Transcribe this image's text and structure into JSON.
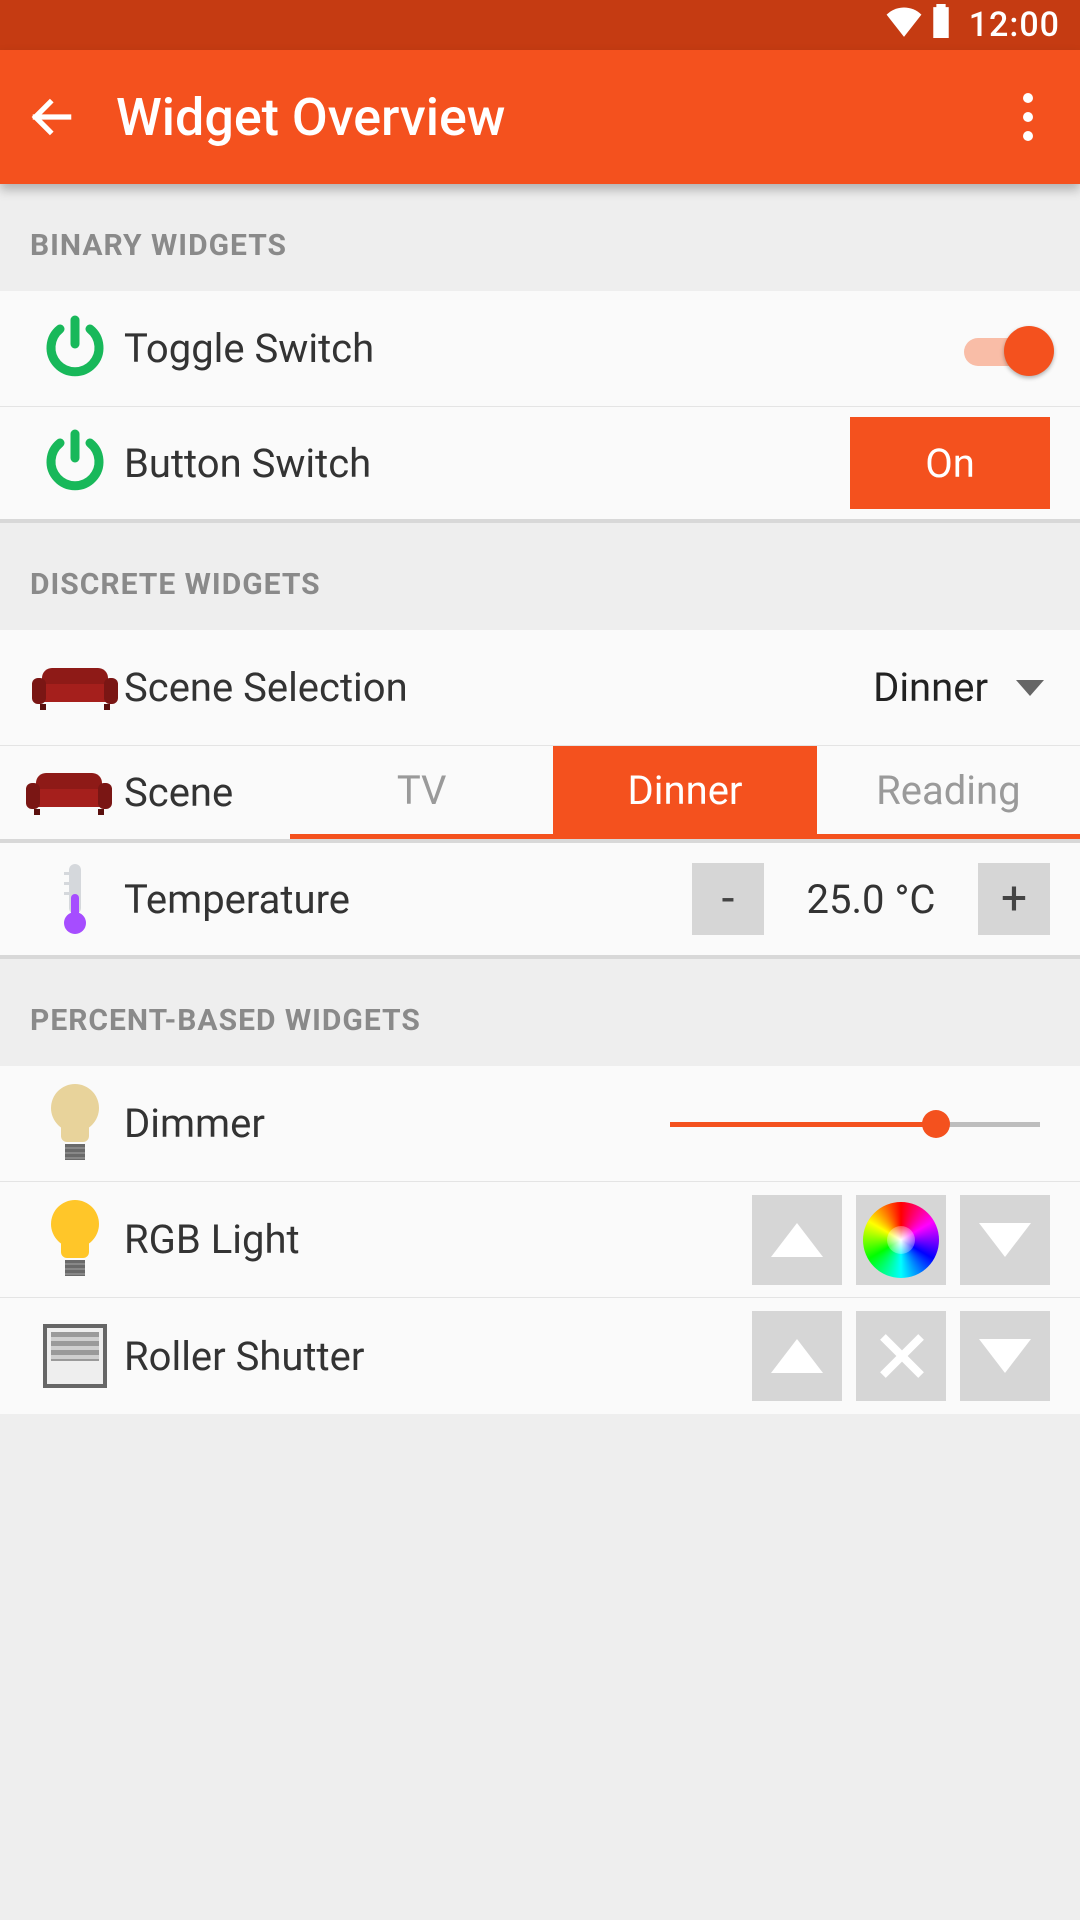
{
  "status": {
    "time": "12:00"
  },
  "appbar": {
    "title": "Widget Overview"
  },
  "sections": {
    "binary": "BINARY WIDGETS",
    "discrete": "DISCRETE WIDGETS",
    "percent": "PERCENT-BASED WIDGETS"
  },
  "toggle": {
    "label": "Toggle Switch",
    "on": true
  },
  "button_switch": {
    "label": "Button Switch",
    "button": "On"
  },
  "scene_select": {
    "label": "Scene Selection",
    "value": "Dinner"
  },
  "scene_tabs": {
    "label": "Scene",
    "options": [
      "TV",
      "Dinner",
      "Reading"
    ],
    "selected": "Dinner"
  },
  "temperature": {
    "label": "Temperature",
    "value": "25.0 °C",
    "minus": "-",
    "plus": "+"
  },
  "dimmer": {
    "label": "Dimmer",
    "percent": 72
  },
  "rgb": {
    "label": "RGB Light"
  },
  "shutter": {
    "label": "Roller Shutter"
  }
}
